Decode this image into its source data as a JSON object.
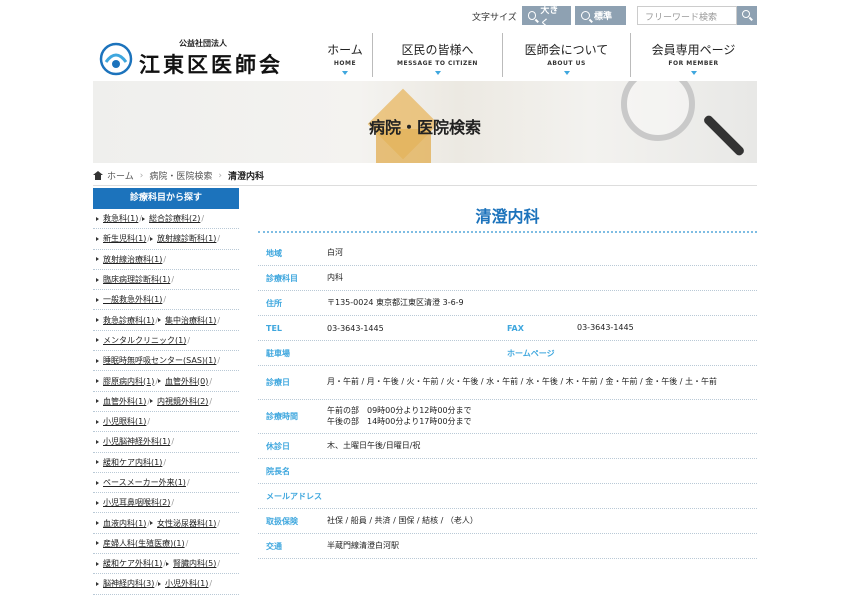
{
  "utility": {
    "font_size_label": "文字サイズ",
    "large_label": "大きく",
    "standard_label": "標準",
    "search_placeholder": "フリーワード検索"
  },
  "header": {
    "org_prefix": "公益社団法人",
    "org_name": "江東区医師会",
    "nav": [
      {
        "jp": "ホーム",
        "en": "HOME"
      },
      {
        "jp": "区民の皆様へ",
        "en": "MESSAGE TO CITIZEN"
      },
      {
        "jp": "医師会について",
        "en": "ABOUT US"
      },
      {
        "jp": "会員専用ページ",
        "en": "FOR MEMBER"
      }
    ]
  },
  "hero": {
    "title": "病院・医院検索"
  },
  "breadcrumb": {
    "home": "ホーム",
    "search": "病院・医院検索",
    "current": "清澄内科"
  },
  "sidebar": {
    "heading": "診療科目から探す",
    "rows": [
      [
        "救急科(1)",
        "総合診療科(2)"
      ],
      [
        "新生児科(1)",
        "放射線診断科(1)"
      ],
      [
        "放射線治療科(1)"
      ],
      [
        "臨床病理診断科(1)"
      ],
      [
        "一般救急外科(1)"
      ],
      [
        "救急診療科(1)",
        "集中治療科(1)"
      ],
      [
        "メンタルクリニック(1)"
      ],
      [
        "睡眠時無呼吸センター(SAS)(1)"
      ],
      [
        "膠原病内科(1)",
        "血管外科(0)"
      ],
      [
        "血管外科(1)",
        "内視鏡外科(2)"
      ],
      [
        "小児眼科(1)"
      ],
      [
        "小児脳神経外科(1)"
      ],
      [
        "緩和ケア内科(1)"
      ],
      [
        "ペースメーカー外来(1)"
      ],
      [
        "小児耳鼻咽喉科(2)"
      ],
      [
        "血液内科(1)",
        "女性泌尿器科(1)"
      ],
      [
        "産婦人科(生殖医療)(1)"
      ],
      [
        "緩和ケア外科(1)",
        "腎臓内科(5)"
      ],
      [
        "脳神経内科(3)",
        "小児外科(1)"
      ]
    ]
  },
  "clinic": {
    "name": "清澄内科",
    "area_label": "地域",
    "area": "白河",
    "dept_label": "診療科目",
    "dept": "内科",
    "address_label": "住所",
    "address": "〒135-0024 東京都江東区清澄 3-6-9",
    "tel_label": "TEL",
    "tel": "03-3643-1445",
    "fax_label": "FAX",
    "fax": "03-3643-1445",
    "parking_label": "駐車場",
    "parking": "",
    "homepage_label": "ホームページ",
    "homepage": "",
    "days_label": "診療日",
    "days": "月・午前 / 月・午後 / 火・午前 / 火・午後 / 水・午前 / 水・午後 / 木・午前 / 金・午前 / 金・午後 / 土・午前",
    "hours_label": "診療時間",
    "hours_am": "午前の部　09時00分より12時00分まで",
    "hours_pm": "午後の部　14時00分より17時00分まで",
    "closed_label": "休診日",
    "closed": "木、土曜日午後/日曜日/祝",
    "director_label": "院長名",
    "director": "",
    "email_label": "メールアドレス",
    "email": "",
    "insurance_label": "取扱保険",
    "insurance": "社保 / 船員 / 共済 / 国保 / 結核 / （老人）",
    "access_label": "交通",
    "access": "半蔵門線清澄白河駅"
  }
}
